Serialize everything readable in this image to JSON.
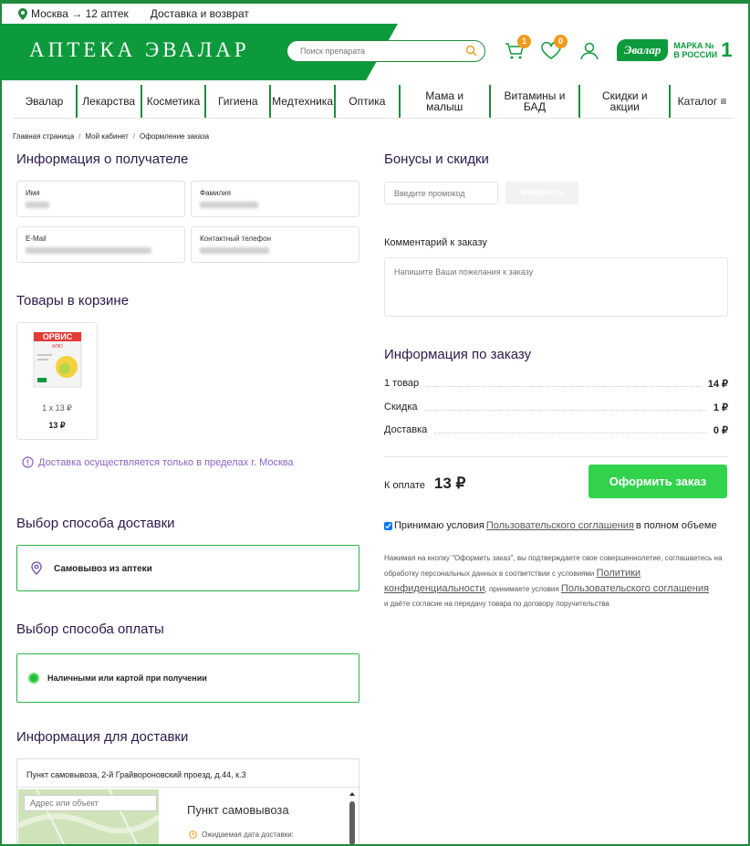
{
  "topbar": {
    "location": "Москва → 12 аптек",
    "delivery": "Доставка и возврат"
  },
  "header": {
    "logo": "АПТЕКА ЭВАЛАР",
    "search_placeholder": "Поиск препарата",
    "cart_count": "1",
    "fav_count": "0",
    "brand_name": "Эвалар",
    "brand_tagline_1": "МАРКА №",
    "brand_tagline_2": "В РОССИИ",
    "brand_num": "1"
  },
  "nav": [
    {
      "label": "Эвалар"
    },
    {
      "label": "Лекарства"
    },
    {
      "label": "Косметика"
    },
    {
      "label": "Гигиена"
    },
    {
      "label": "Медтехника"
    },
    {
      "label": "Оптика"
    },
    {
      "label": "Мама и малыш"
    },
    {
      "label": "Витамины и БАД"
    },
    {
      "label": "Скидки и акции"
    },
    {
      "label": "Каталог ≡"
    }
  ],
  "breadcrumbs": [
    "Главная страница",
    "Мой кабинет",
    "Оформление заказа"
  ],
  "recipient": {
    "title": "Информация о получателе",
    "name_label": "Имя",
    "surname_label": "Фамилия",
    "email_label": "E-Mail",
    "phone_label": "Контактный телефон"
  },
  "cart": {
    "title": "Товары в корзине",
    "product_brand": "ОРВИС",
    "product_sub": "ФЛЮ",
    "qty_text": "1 x",
    "unit_price": "13 ₽",
    "total": "13 ₽"
  },
  "notice": "Доставка осуществляется только в пределах г. Москва",
  "delivery": {
    "title": "Выбор способа доставки",
    "option": "Самовывоз из аптеки"
  },
  "payment": {
    "title": "Выбор способа оплаты",
    "option": "Наличными или картой при получении"
  },
  "delivery_info": {
    "title": "Информация для доставки",
    "address": "Пункт самовывоза, 2-й Грайвороновский проезд, д.44, к.3",
    "map_placeholder": "Адрес или объект",
    "pickup_title": "Пункт самовывоза",
    "expected_date": "Ожидаемая дата доставки:"
  },
  "bonuses": {
    "title": "Бонусы и скидки",
    "promo_placeholder": "Введите промокод",
    "apply": "ПРИМЕНИТЬ"
  },
  "comment": {
    "label": "Комментарий к заказу",
    "placeholder": "Напишите Ваши пожелания к заказу"
  },
  "order": {
    "title": "Информация по заказу",
    "rows": [
      {
        "label": "1 товар",
        "value": "14 ₽"
      },
      {
        "label": "Скидка",
        "value": "1 ₽"
      },
      {
        "label": "Доставка",
        "value": "0 ₽"
      }
    ],
    "pay_label": "К оплате",
    "pay_value": "13 ₽",
    "submit": "Оформить заказ"
  },
  "agreement": {
    "pre": "Принимаю условия",
    "link": "Пользовательского соглашения",
    "post": "в полном объеме",
    "checked": true
  },
  "legal": {
    "t1": "Нажимая на кнопку \"Оформить заказ\", вы подтверждаете свое совершеннолетие, соглашаетесь на обработку персональных данных в соответствии с условиями",
    "l1": "Политики конфиденциальности",
    "t2": ", принимаете условия",
    "l2": "Пользовательского соглашения",
    "t3": "и даёте согласие на передачу товара по договору поручительства"
  }
}
